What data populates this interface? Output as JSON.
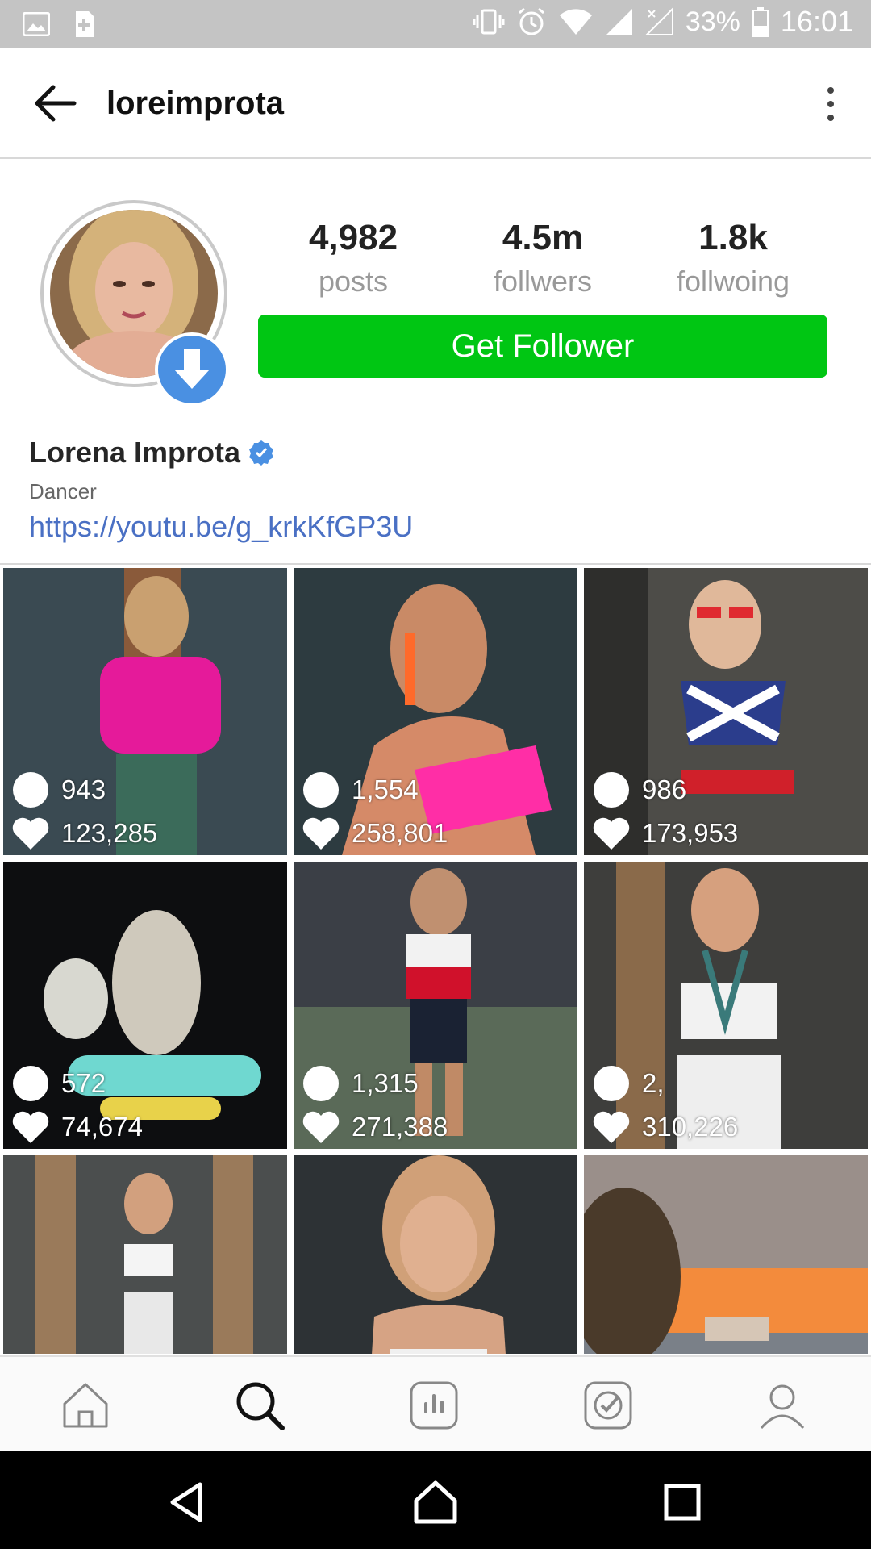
{
  "status_bar": {
    "battery": "33%",
    "time": "16:01"
  },
  "app_bar": {
    "title": "loreimprota"
  },
  "profile": {
    "stats": [
      {
        "value": "4,982",
        "label": "posts"
      },
      {
        "value": "4.5m",
        "label": "follwers"
      },
      {
        "value": "1.8k",
        "label": "follwoing"
      }
    ],
    "cta_label": "Get Follower",
    "name": "Lorena Improta",
    "role": "Dancer",
    "link": "https://youtu.be/g_krkKfGP3U"
  },
  "posts": [
    {
      "comments": "943",
      "likes": "123,285",
      "bg": "#3a4a52",
      "accent": "#e51a9a"
    },
    {
      "comments": "1,554",
      "likes": "258,801",
      "bg": "#2d3b40",
      "accent": "#ff2ea6"
    },
    {
      "comments": "986",
      "likes": "173,953",
      "bg": "#4d4c48",
      "accent": "#2b3d8c"
    },
    {
      "comments": "572",
      "likes": "74,674",
      "bg": "#0d0e10",
      "accent": "#6fd8d0"
    },
    {
      "comments": "1,315",
      "likes": "271,388",
      "bg": "#5a6a58",
      "accent": "#d0112b"
    },
    {
      "comments": "2,",
      "likes": "310,226",
      "bg": "#3e3e3c",
      "accent": "#f2f2f2"
    },
    {
      "comments": "",
      "likes": "",
      "bg": "#4b4e4e",
      "accent": "#f4f4f4"
    },
    {
      "comments": "",
      "likes": "",
      "bg": "#2d3235",
      "accent": "#f0f0f0"
    },
    {
      "comments": "",
      "likes": "",
      "bg": "#9a8f8a",
      "accent": "#f38b3c"
    }
  ],
  "colors": {
    "cta": "#00c613",
    "link": "#4a70c4",
    "verified": "#4a90e2"
  }
}
